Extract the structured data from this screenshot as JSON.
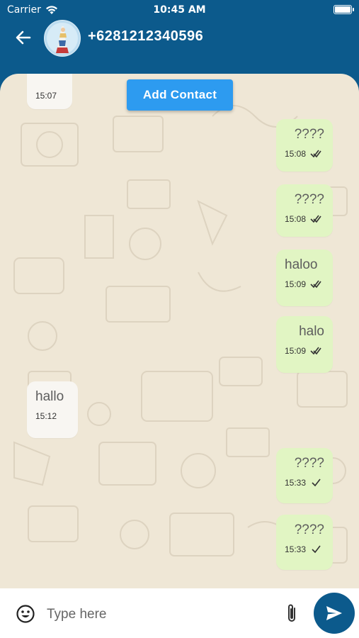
{
  "status_bar": {
    "carrier": "Carrier",
    "time": "10:45 AM"
  },
  "header": {
    "contact_name": "+6281212340596"
  },
  "actions": {
    "add_contact_label": "Add Contact"
  },
  "messages": [
    {
      "direction": "in",
      "text": "",
      "time": "15:07"
    },
    {
      "direction": "out",
      "text": "????",
      "time": "15:08"
    },
    {
      "direction": "out",
      "text": "????",
      "time": "15:08"
    },
    {
      "direction": "out",
      "text": "haloo",
      "time": "15:09"
    },
    {
      "direction": "out",
      "text": "halo",
      "time": "15:09"
    },
    {
      "direction": "in",
      "text": "hallo",
      "time": "15:12"
    },
    {
      "direction": "out",
      "text": "????",
      "time": "15:33"
    },
    {
      "direction": "out",
      "text": "????",
      "time": "15:33"
    }
  ],
  "composer": {
    "placeholder": "Type here"
  },
  "colors": {
    "header": "#0c5a8c",
    "outgoing_bubble": "#e1f5c3",
    "incoming_bubble": "#f8f6f2",
    "chat_background": "#efe7d6",
    "add_contact_button": "#2d9bf0"
  }
}
